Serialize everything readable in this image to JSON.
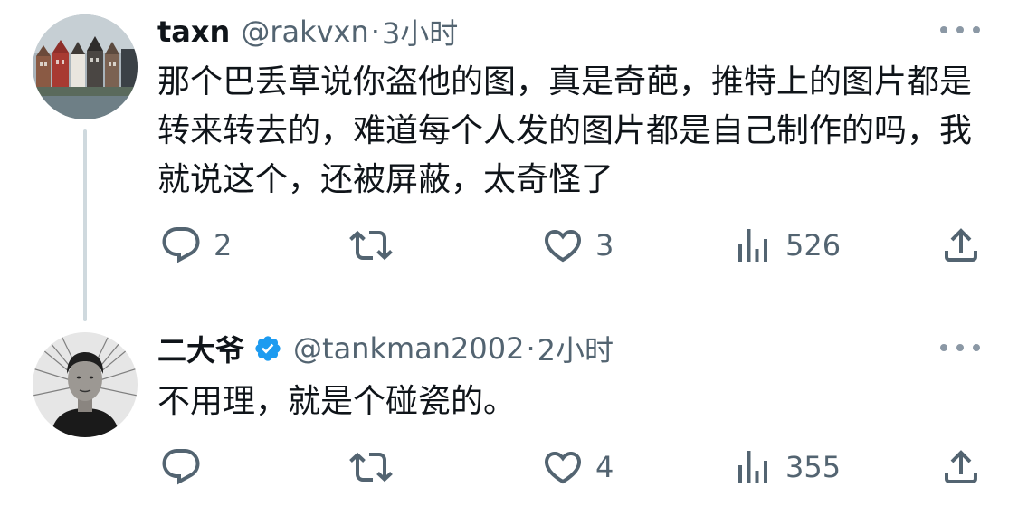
{
  "tweets": [
    {
      "author_name": "taxn",
      "handle": "@rakvxn",
      "separator": "·",
      "time": "3小时",
      "verified": false,
      "avatar_icon": "canal-houses-photo",
      "text": "那个巴丢草说你盗他的图，真是奇葩，推特上的图片都是转来转去的，难道每个人发的图片都是自己制作的吗，我就说这个，还被屏蔽，太奇怪了",
      "replies": "2",
      "retweets": "",
      "likes": "3",
      "views": "526"
    },
    {
      "author_name": "二大爷",
      "handle": "@tankman2002",
      "separator": "·",
      "time": "2小时",
      "verified": true,
      "avatar_icon": "man-portrait-photo",
      "text": "不用理，就是个碰瓷的。",
      "replies": "",
      "retweets": "",
      "likes": "4",
      "views": "355"
    }
  ],
  "colors": {
    "text_primary": "#0f1419",
    "text_secondary": "#536471",
    "verified_badge": "#1d9bf0",
    "thread_line": "#cfd9de"
  },
  "icons": {
    "reply": "speech-bubble-icon",
    "retweet": "retweet-arrows-icon",
    "like": "heart-icon",
    "views": "bar-chart-icon",
    "share": "share-upload-icon",
    "more": "ellipsis-icon",
    "verified": "verified-badge-icon"
  }
}
